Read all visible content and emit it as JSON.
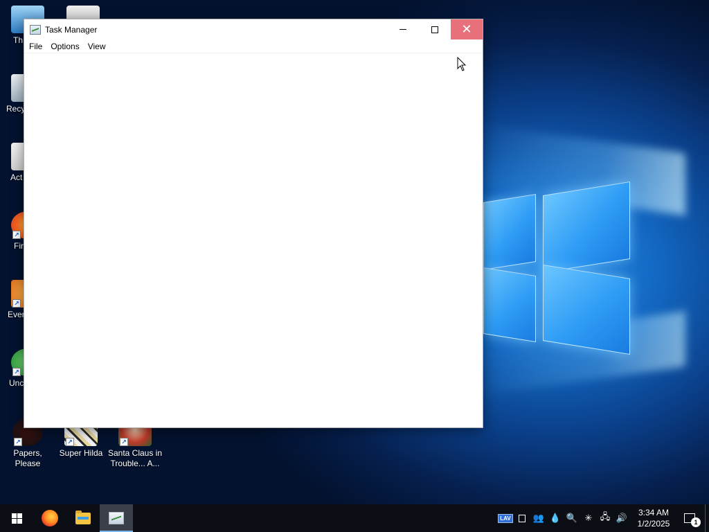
{
  "desktop": {
    "icons": [
      {
        "label": "Th",
        "icon": "this-pc-icon"
      },
      {
        "label": "Recy",
        "icon": "recycle-bin-icon"
      },
      {
        "label": "Act",
        "icon": "folder-icon"
      },
      {
        "label": "Fir",
        "icon": "firefox-icon"
      },
      {
        "label": "Ever",
        "icon": "game-icon"
      },
      {
        "label": "Unc",
        "icon": "game-icon"
      },
      {
        "label": "Papers, Please",
        "icon": "papers-please-icon"
      },
      {
        "label": "Super Hilda",
        "icon": "super-hilda-icon"
      },
      {
        "label": "Santa Claus in Trouble... A...",
        "icon": "santa-claus-icon"
      }
    ],
    "wallpaper_accent": "#2e9cf5"
  },
  "window": {
    "title": "Task Manager",
    "icon": "task-manager-icon",
    "controls": {
      "minimize": "minimize-icon",
      "maximize": "maximize-icon",
      "close": "close-icon",
      "close_color": "#e8707a"
    },
    "menu": [
      "File",
      "Options",
      "View"
    ]
  },
  "taskbar": {
    "pinned": [
      {
        "name": "start",
        "icon": "windows-start-icon"
      },
      {
        "name": "firefox",
        "icon": "firefox-icon"
      },
      {
        "name": "file-explorer",
        "icon": "folder-icon"
      },
      {
        "name": "task-manager",
        "icon": "task-manager-icon",
        "active": true
      }
    ],
    "tray_icons": [
      "lav-icon",
      "square-icon",
      "people-icon",
      "droplet-icon",
      "search-magnifier-icon",
      "snowflake-icon",
      "network-icon",
      "volume-icon"
    ],
    "clock": {
      "time": "3:34 AM",
      "date": "1/2/2025"
    },
    "notifications": {
      "count": "1"
    }
  }
}
